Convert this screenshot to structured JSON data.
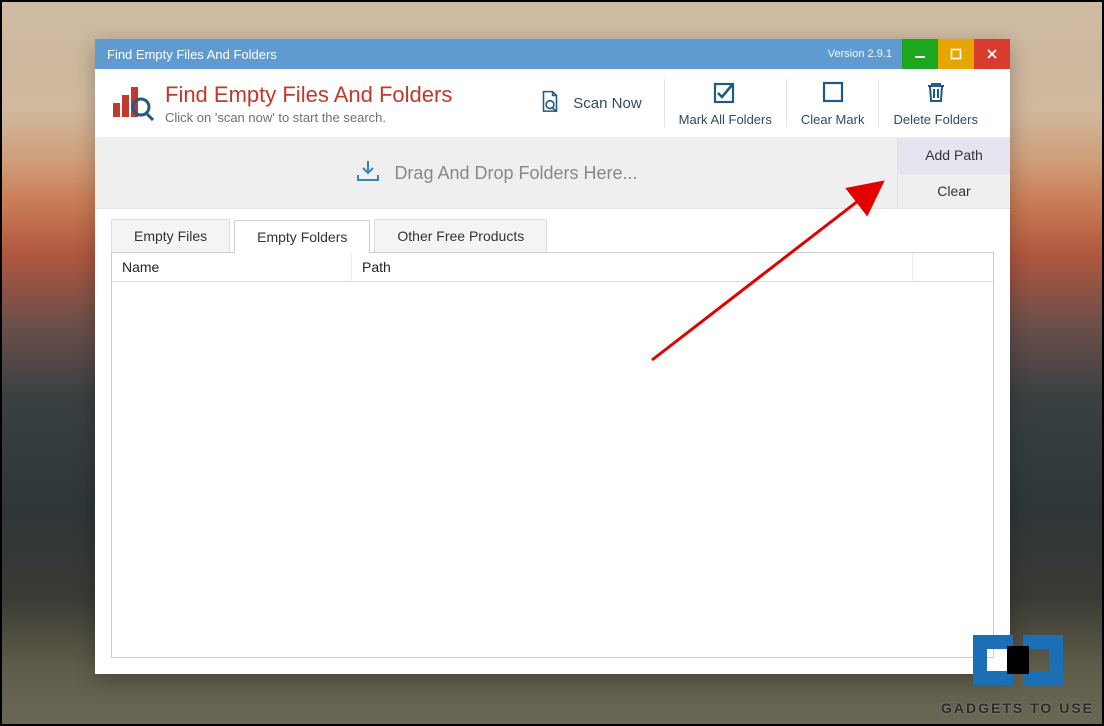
{
  "window": {
    "title": "Find Empty Files And Folders",
    "version": "Version 2.9.1"
  },
  "brand": {
    "title": "Find Empty Files And Folders",
    "subtitle": "Click on 'scan now' to start the search."
  },
  "toolbar": {
    "scan_now": "Scan Now",
    "mark_all": "Mark All Folders",
    "clear_mark": "Clear Mark",
    "delete_folders": "Delete Folders"
  },
  "dropzone": {
    "placeholder": "Drag And Drop Folders Here..."
  },
  "sidebuttons": {
    "add_path": "Add Path",
    "clear": "Clear"
  },
  "tabs": {
    "empty_files": "Empty Files",
    "empty_folders": "Empty Folders",
    "other_products": "Other Free Products",
    "active": "empty_folders"
  },
  "table": {
    "columns": {
      "name": "Name",
      "path": "Path"
    },
    "rows": []
  },
  "watermark": {
    "text": "GADGETS TO USE"
  }
}
